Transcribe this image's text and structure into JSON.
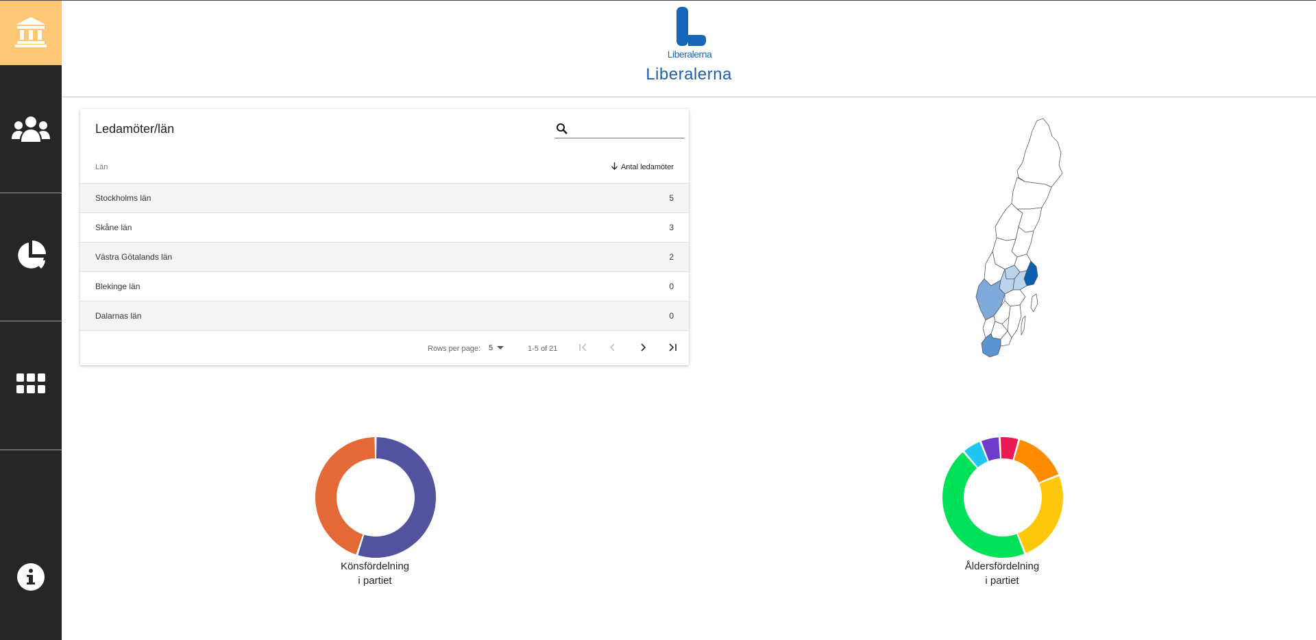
{
  "sidebar": {
    "items": [
      {
        "name": "home",
        "icon": "bank-icon",
        "active": true
      },
      {
        "name": "members",
        "icon": "users-icon"
      },
      {
        "name": "statistics",
        "icon": "pie-chart-icon"
      },
      {
        "name": "apps",
        "icon": "grid-icon"
      },
      {
        "name": "info",
        "icon": "info-icon"
      }
    ],
    "active_color": "#fdc776",
    "background": "#262626"
  },
  "header": {
    "logo_text": "Liberalerna",
    "party_name": "Liberalerna"
  },
  "table": {
    "title": "Ledamöter/län",
    "search": {
      "value": "",
      "placeholder": ""
    },
    "columns": {
      "lan": "Län",
      "count": "Antal ledamöter"
    },
    "rows": [
      {
        "lan": "Stockholms län",
        "count": "5"
      },
      {
        "lan": "Skåne län",
        "count": "3"
      },
      {
        "lan": "Västra Götalands län",
        "count": "2"
      },
      {
        "lan": "Blekinge län",
        "count": "0"
      },
      {
        "lan": "Dalarnas län",
        "count": "0"
      }
    ],
    "footer": {
      "rows_per_page_label": "Rows per page:",
      "rows_per_page": "5",
      "range": "1-5 of 21"
    }
  },
  "map": {
    "icon": "sweden-map",
    "colors": {
      "high": "#0b5fae",
      "mid": "#5b93cf",
      "low": "#bcd3ec",
      "none": "#ffffff"
    }
  },
  "chart_data": [
    {
      "type": "pie",
      "donut": true,
      "title": "Könsfördelning\ni partiet",
      "slices": [
        {
          "value": 55,
          "color": "#52529e"
        },
        {
          "value": 45,
          "color": "#e36a37"
        }
      ]
    },
    {
      "type": "pie",
      "donut": true,
      "title": "Åldersfördelning\ni partiet",
      "slices": [
        {
          "value": 5,
          "color": "#ea1a55"
        },
        {
          "value": 14,
          "color": "#ff8c00"
        },
        {
          "value": 24,
          "color": "#fdc80c"
        },
        {
          "value": 43,
          "color": "#00e059"
        },
        {
          "value": 5,
          "color": "#21c6f0"
        },
        {
          "value": 5,
          "color": "#6d3fc8"
        }
      ]
    }
  ]
}
